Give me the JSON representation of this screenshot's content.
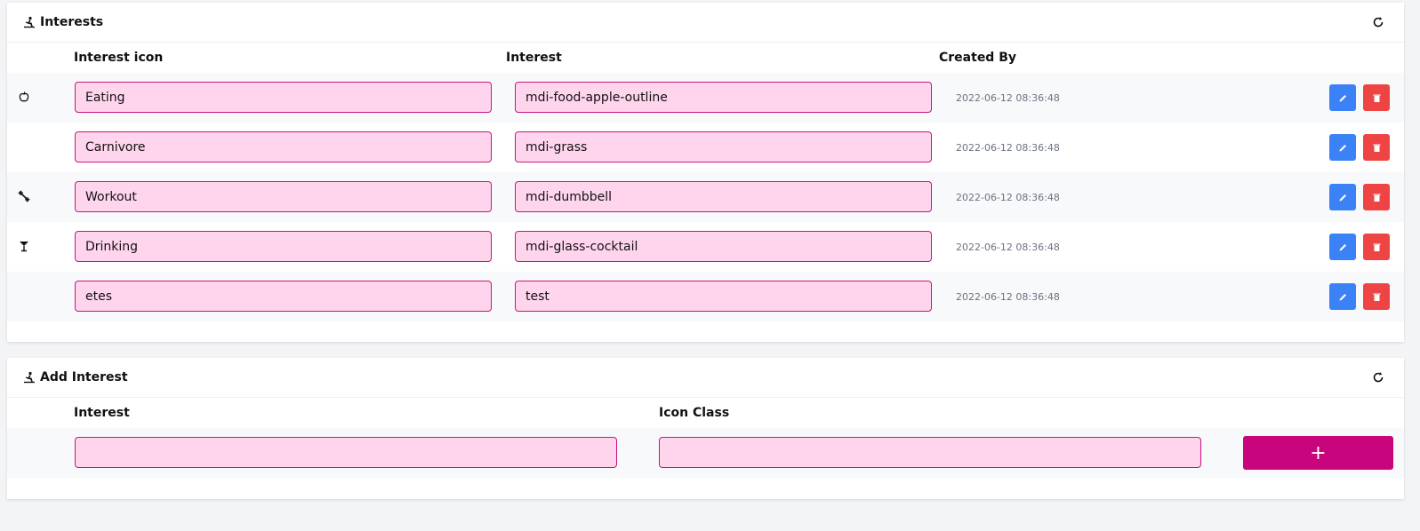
{
  "interests": {
    "title": "Interests",
    "title_icon": "rowing-icon",
    "refresh_icon": "refresh-icon",
    "columns": {
      "icon": "Interest icon",
      "interest": "Interest",
      "created_by": "Created By"
    },
    "rows": [
      {
        "icon": "apple-icon",
        "name": "Eating",
        "icon_class": "mdi-food-apple-outline",
        "created": "2022-06-12 08:36:48"
      },
      {
        "icon": "",
        "name": "Carnivore",
        "icon_class": "mdi-grass",
        "created": "2022-06-12 08:36:48"
      },
      {
        "icon": "dumbbell-icon",
        "name": "Workout",
        "icon_class": "mdi-dumbbell",
        "created": "2022-06-12 08:36:48"
      },
      {
        "icon": "cocktail-icon",
        "name": "Drinking",
        "icon_class": "mdi-glass-cocktail",
        "created": "2022-06-12 08:36:48"
      },
      {
        "icon": "",
        "name": "etes",
        "icon_class": "test",
        "created": "2022-06-12 08:36:48"
      }
    ],
    "colors": {
      "field_bg": "#ffd5ee",
      "field_border": "#c9157f",
      "edit": "#3b82f6",
      "delete": "#ef4444"
    }
  },
  "add": {
    "title": "Add Interest",
    "title_icon": "rowing-icon",
    "refresh_icon": "refresh-icon",
    "columns": {
      "interest": "Interest",
      "icon_class": "Icon Class"
    },
    "interest_value": "",
    "icon_class_value": "",
    "add_label": "+",
    "colors": {
      "add_button": "#c8057c"
    }
  }
}
